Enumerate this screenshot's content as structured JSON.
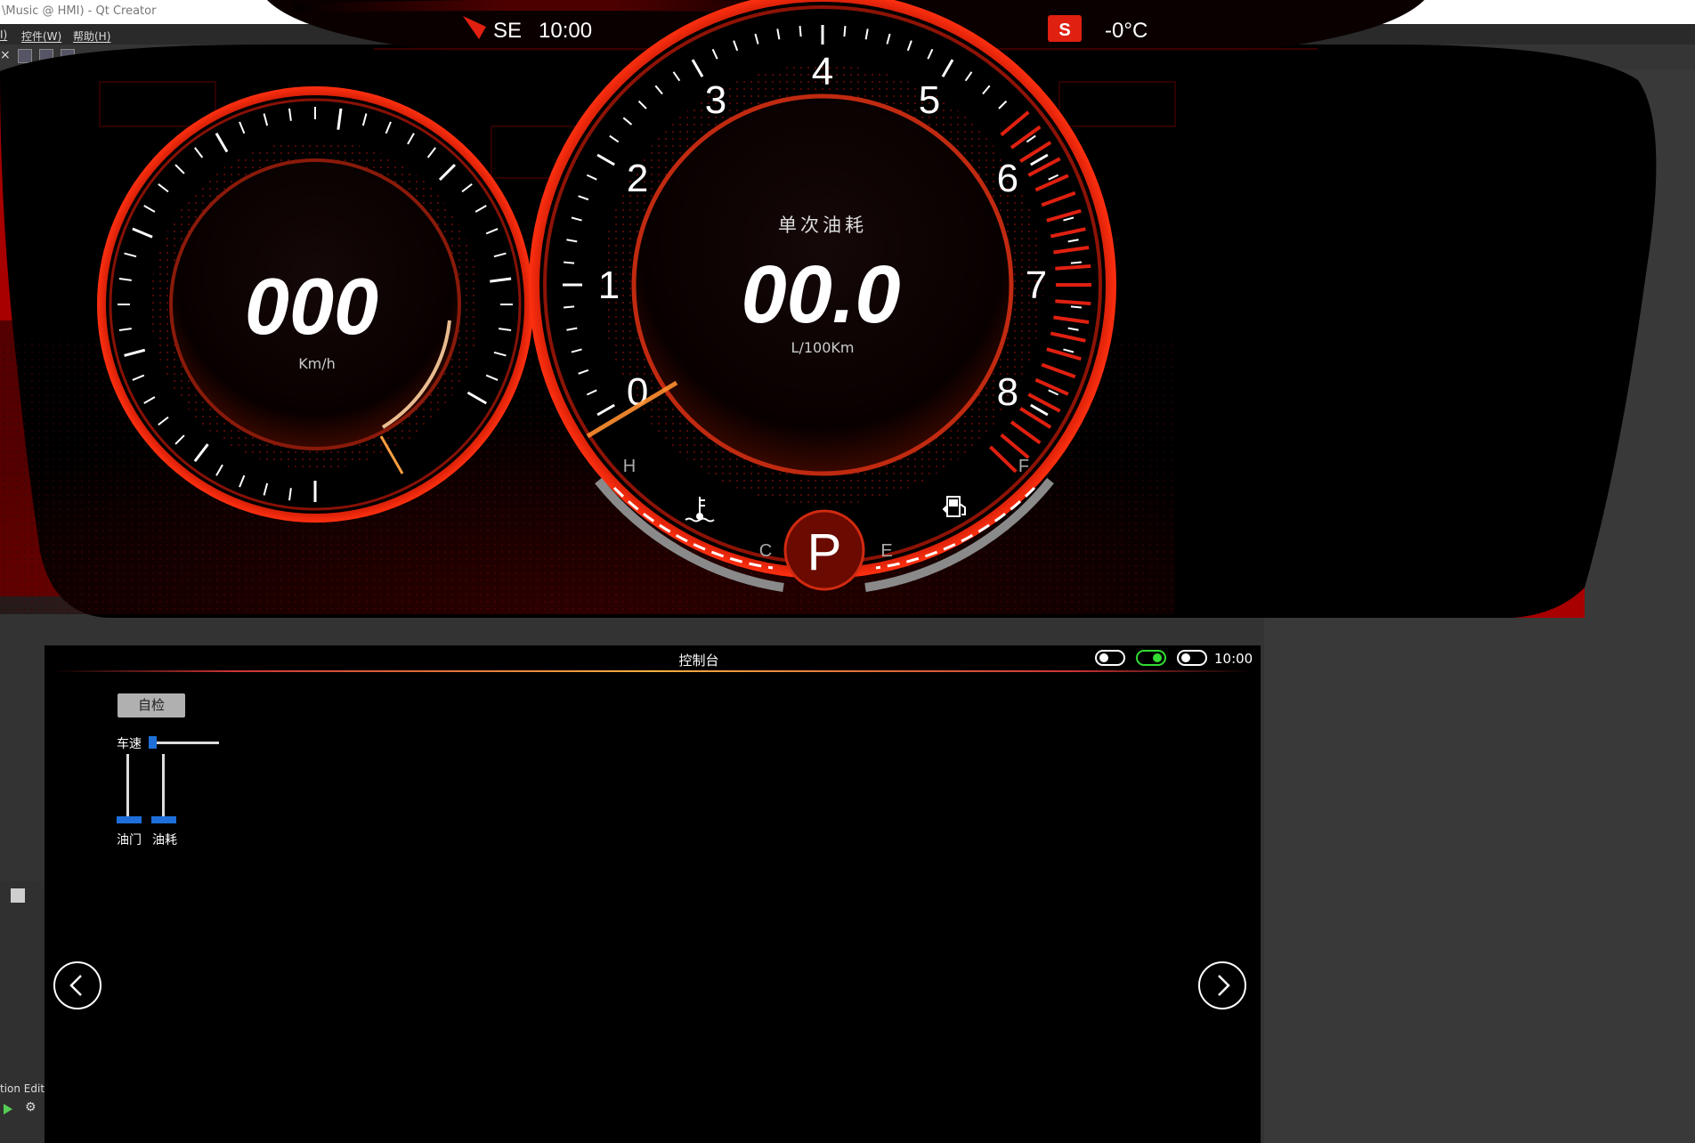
{
  "creator": {
    "window_title": "\\Music @ HMI) - Qt Creator",
    "menu": [
      "I)",
      "控件(W)",
      "帮助(H)"
    ],
    "bottom_left_label": "tion Edit",
    "left_icon_text": "×"
  },
  "colors": {
    "accent_red": "#e02010",
    "panel_red": "#a80000",
    "toggle_on": "#33dd33",
    "slider_blue": "#1e6fd9"
  },
  "cluster": {
    "heading": "SE",
    "time": "10:00",
    "gear_badge": "S",
    "outside_temp": "-0°C",
    "speed": {
      "value": "000",
      "unit": "Km/h"
    },
    "fuel_gauge": {
      "title": "单次油耗",
      "value": "00.0",
      "unit": "L/100Km",
      "ticks": [
        "0",
        "1",
        "2",
        "3",
        "4",
        "5",
        "6",
        "7",
        "8"
      ]
    },
    "temp_gauge": {
      "high": "H",
      "low": "C",
      "icon": "coolant-temperature-icon"
    },
    "fuel_level": {
      "full": "F",
      "empty": "E",
      "icon": "fuel-pump-icon"
    },
    "gear": "P"
  },
  "console": {
    "title": "控制台",
    "clock": "10:00",
    "toggles": [
      {
        "name": "toggle-1",
        "on": false
      },
      {
        "name": "toggle-2",
        "on": true
      },
      {
        "name": "toggle-3",
        "on": false
      }
    ],
    "selfcheck_label": "自检",
    "speed_label": "车速",
    "throttle_label": "油门",
    "fuelcons_label": "油耗",
    "prev_icon": "chevron-left-icon",
    "next_icon": "chevron-right-icon"
  }
}
